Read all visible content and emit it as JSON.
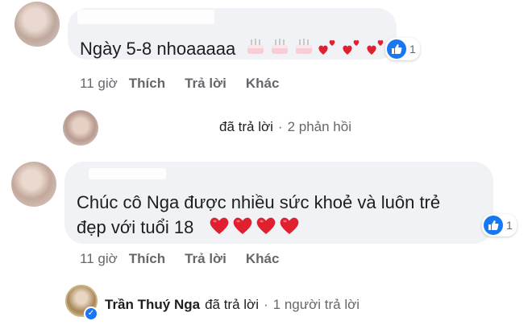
{
  "comment1": {
    "text": "Ngày 5-8 nhoaaaaa",
    "emojis": [
      "birthday-cake",
      "birthday-cake",
      "birthday-cake",
      "two-hearts",
      "two-hearts",
      "two-hearts"
    ],
    "reaction": {
      "icon": "like-icon",
      "count": "1"
    },
    "actions": {
      "time": "11 giờ",
      "like": "Thích",
      "reply": "Trả lời",
      "more": "Khác"
    }
  },
  "replies_summary": {
    "replied": "đã trả lời",
    "separator": "·",
    "count": "2 phản hồi"
  },
  "comment2": {
    "line1": "Chúc cô Nga được nhiều sức khoẻ và luôn trẻ",
    "line2": "đẹp với tuổi 18",
    "emojis": [
      "red-heart",
      "red-heart",
      "red-heart",
      "red-heart"
    ],
    "reaction": {
      "icon": "like-icon",
      "count": "1"
    },
    "actions": {
      "time": "11 giờ",
      "like": "Thích",
      "reply": "Trả lời",
      "more": "Khác"
    }
  },
  "page_reply": {
    "name": "Trần Thuý Nga",
    "replied": "đã trả lời",
    "separator": "·",
    "count": "1 người trả lời"
  },
  "colors": {
    "bubble": "#f0f2f5",
    "link_blue": "#1877f2",
    "muted": "#65676b",
    "heart": "#e0202f"
  }
}
